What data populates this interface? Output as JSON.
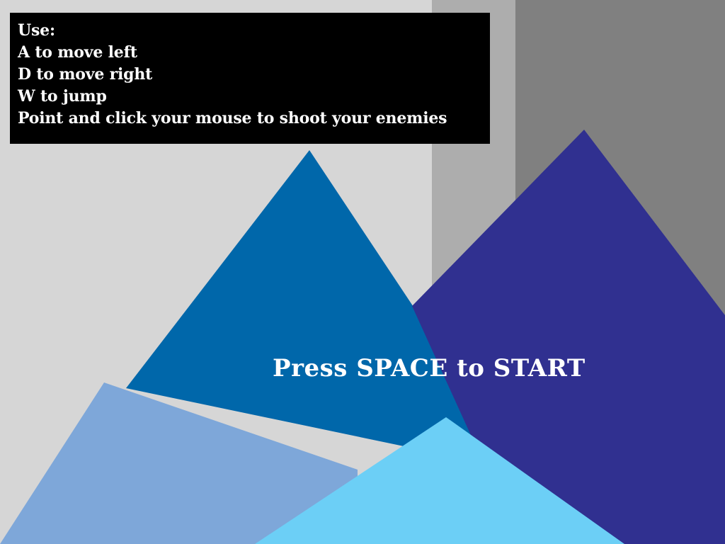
{
  "instructions": {
    "lines": [
      "Use:",
      "A to move left",
      "D to move right",
      "W to jump",
      "Point and click your mouse to shoot your enemies"
    ]
  },
  "start_prompt": "Press SPACE to START",
  "colors": {
    "background": "#d6d6d6",
    "building_light": "#adadad",
    "building_dark": "#808080",
    "mountain_blue": "#0067aa",
    "mountain_indigo": "#303090",
    "mountain_pale": "#7ea7d9",
    "mountain_sky": "#6ccff6",
    "instructions_bg": "#000000",
    "text": "#ffffff"
  }
}
